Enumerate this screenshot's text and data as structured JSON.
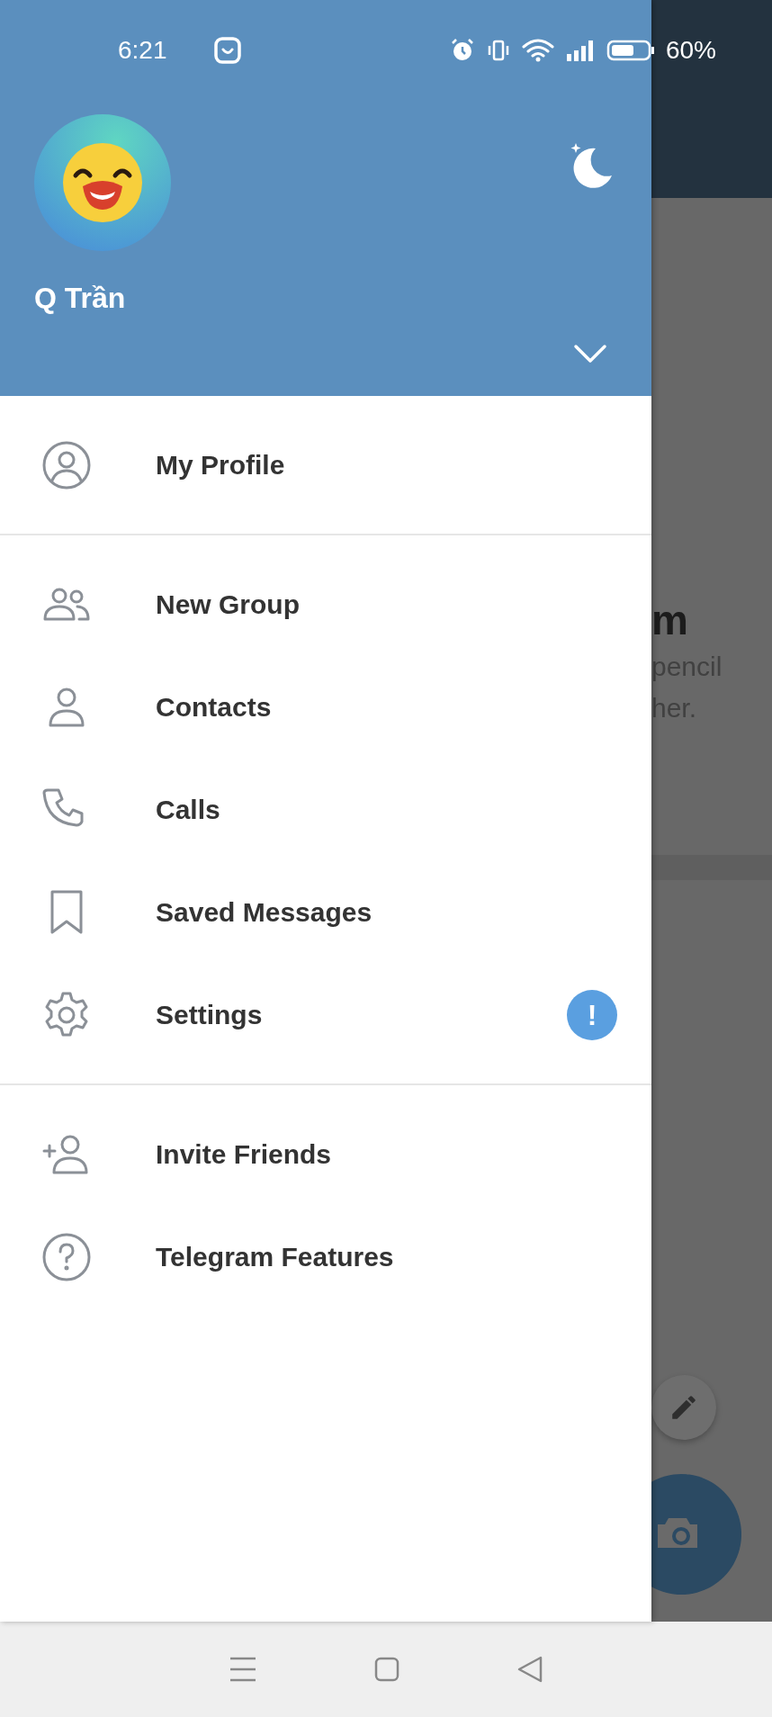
{
  "status_bar": {
    "time": "6:21",
    "battery": "60%"
  },
  "profile": {
    "name": "Q Trần"
  },
  "menu_sections": [
    [
      {
        "label": "My Profile"
      }
    ],
    [
      {
        "label": "New Group"
      },
      {
        "label": "Contacts"
      },
      {
        "label": "Calls"
      },
      {
        "label": "Saved Messages"
      },
      {
        "label": "Settings",
        "badge": "!"
      }
    ],
    [
      {
        "label": "Invite Friends"
      },
      {
        "label": "Telegram Features"
      }
    ]
  ],
  "background": {
    "title": "m",
    "text_lines": [
      "pencil",
      "her."
    ]
  }
}
